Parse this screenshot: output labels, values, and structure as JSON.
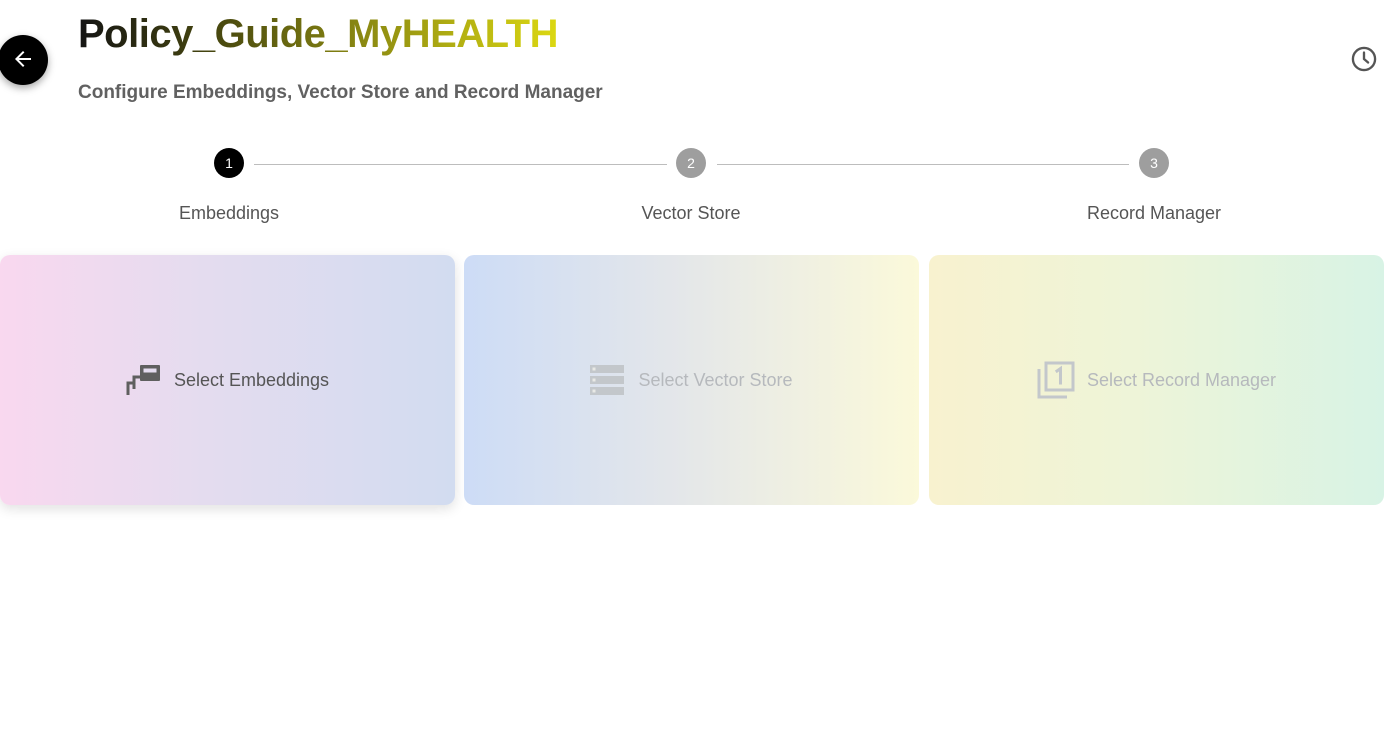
{
  "header": {
    "title": "Policy_Guide_MyHEALTH",
    "subtitle": "Configure Embeddings, Vector Store and Record Manager"
  },
  "stepper": {
    "steps": [
      {
        "number": "1",
        "label": "Embeddings",
        "state": "active"
      },
      {
        "number": "2",
        "label": "Vector Store",
        "state": "inactive"
      },
      {
        "number": "3",
        "label": "Record Manager",
        "state": "inactive"
      }
    ]
  },
  "cards": {
    "embeddings": {
      "label": "Select Embeddings",
      "icon": "stacked-cards-icon",
      "enabled": true
    },
    "vector_store": {
      "label": "Select Vector Store",
      "icon": "database-list-icon",
      "enabled": false
    },
    "record_manager": {
      "label": "Select Record Manager",
      "icon": "filter-1-icon",
      "enabled": false
    }
  },
  "icons": {
    "back": "arrow-left-icon",
    "history": "clock-icon"
  },
  "colors": {
    "step_active": "#000000",
    "step_inactive": "#9e9e9e",
    "title_gradient_start": "#141414",
    "title_gradient_end": "#dcd812"
  }
}
